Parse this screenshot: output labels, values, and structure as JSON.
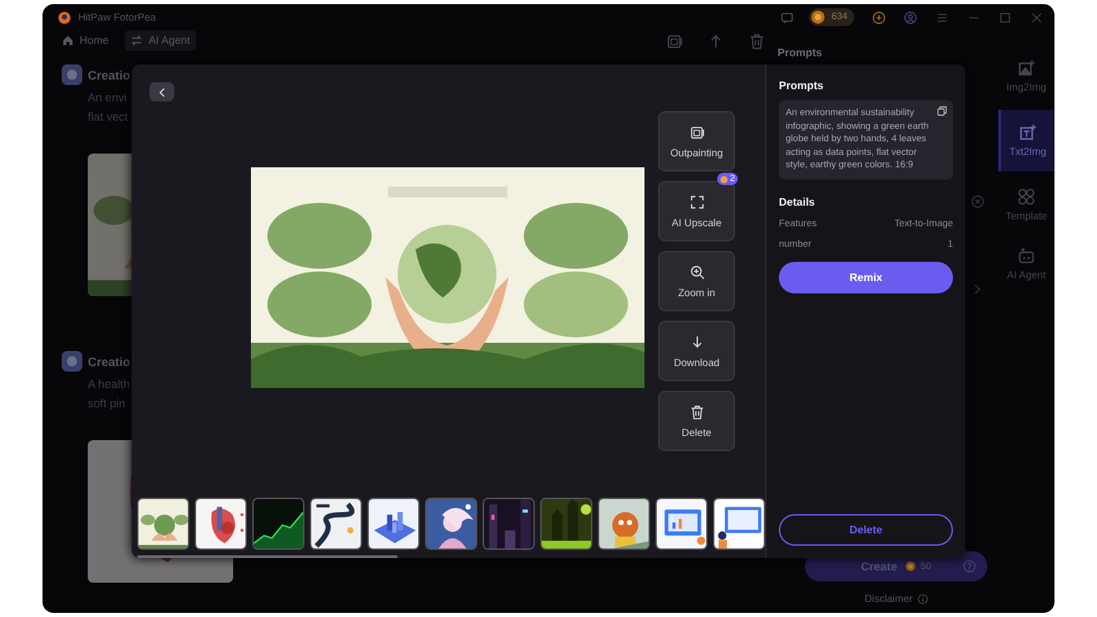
{
  "app": {
    "title": "HitPaw FotorPea",
    "credits": "634"
  },
  "toolbar": {
    "tabs": [
      {
        "label": "Home",
        "selected": false
      },
      {
        "label": "AI Agent",
        "selected": true
      }
    ]
  },
  "history": [
    {
      "title": "Creatio",
      "lines": [
        "An envi",
        "flat vect"
      ]
    },
    {
      "title": "Creatio",
      "lines": [
        "A health",
        "soft pin"
      ]
    }
  ],
  "panel": {
    "heading": "Prompts",
    "create": {
      "label": "Create",
      "cost": "50"
    },
    "disclaimer": "Disclaimer"
  },
  "rail": [
    {
      "label": "Img2Img",
      "selected": false
    },
    {
      "label": "Txt2Img",
      "selected": true
    },
    {
      "label": "Template",
      "selected": false
    },
    {
      "label": "AI Agent",
      "selected": false
    }
  ],
  "viewer": {
    "actions": [
      {
        "label": "Outpainting"
      },
      {
        "label": "AI Upscale",
        "badge": "2"
      },
      {
        "label": "Zoom in"
      },
      {
        "label": "Download"
      },
      {
        "label": "Delete"
      }
    ],
    "sidebar": {
      "heading": "Prompts",
      "prompt": "An environmental sustainability infographic, showing a green earth globe held by two hands, 4 leaves acting as data points, flat vector style, earthy green colors. 16:9",
      "section": "Details",
      "rows": [
        {
          "label": "Features",
          "value": "Text-to-Image"
        },
        {
          "label": "number",
          "value": "1"
        }
      ],
      "primary": "Remix",
      "danger": "Delete"
    }
  }
}
